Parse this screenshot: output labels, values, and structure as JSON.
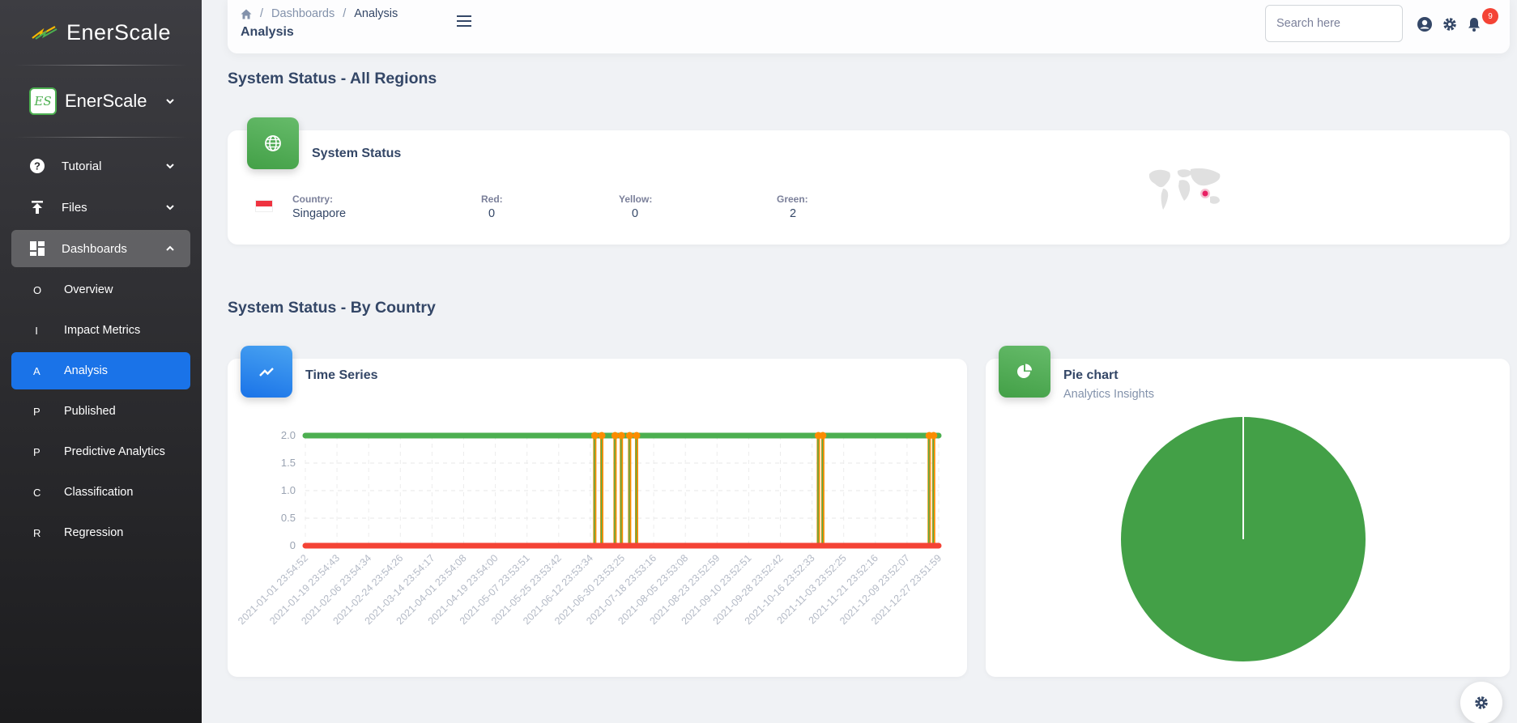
{
  "sidebar": {
    "brand": "EnerScale",
    "org_name": "EnerScale",
    "org_logo_text": "ES",
    "nav": [
      {
        "label": "Tutorial",
        "icon": "help-circle-icon"
      },
      {
        "label": "Files",
        "icon": "upload-icon"
      },
      {
        "label": "Dashboards",
        "icon": "dashboard-icon"
      }
    ],
    "sub_items": [
      {
        "letter": "O",
        "label": "Overview"
      },
      {
        "letter": "I",
        "label": "Impact Metrics"
      },
      {
        "letter": "A",
        "label": "Analysis"
      },
      {
        "letter": "P",
        "label": "Published"
      },
      {
        "letter": "P",
        "label": "Predictive Analytics"
      },
      {
        "letter": "C",
        "label": "Classification"
      },
      {
        "letter": "R",
        "label": "Regression"
      }
    ]
  },
  "topbar": {
    "breadcrumb": [
      "Dashboards",
      "Analysis"
    ],
    "page_title": "Analysis",
    "search_placeholder": "Search here",
    "notification_count": "9"
  },
  "sections": {
    "all_regions": "System Status - All Regions",
    "by_country": "System Status - By Country"
  },
  "status_card": {
    "title": "System Status",
    "country_label": "Country:",
    "country": "Singapore",
    "red_label": "Red:",
    "red": "0",
    "yellow_label": "Yellow:",
    "yellow": "0",
    "green_label": "Green:",
    "green": "2"
  },
  "timeseries_card": {
    "title": "Time Series"
  },
  "pie_card": {
    "title": "Pie chart",
    "subtitle": "Analytics Insights"
  },
  "colors": {
    "accent": "#1a73e8",
    "green": "#4caf50",
    "orange": "#fb8c00",
    "red": "#f44335"
  },
  "chart_data": [
    {
      "type": "line",
      "title": "",
      "ylim": [
        0,
        2
      ],
      "yticks": [
        "2.0",
        "1.5",
        "1.0",
        "0.5",
        "0"
      ],
      "x": [
        "2021-01-01 23:54:52",
        "2021-01-19 23:54:43",
        "2021-02-06 23:54:34",
        "2021-02-24 23:54:26",
        "2021-03-14 23:54:17",
        "2021-04-01 23:54:08",
        "2021-04-19 23:54:00",
        "2021-05-07 23:53:51",
        "2021-05-25 23:53:42",
        "2021-06-12 23:53:34",
        "2021-06-30 23:53:25",
        "2021-07-18 23:53:16",
        "2021-08-05 23:53:08",
        "2021-08-23 23:52:59",
        "2021-09-10 23:52:51",
        "2021-09-28 23:52:42",
        "2021-10-16 23:52:33",
        "2021-11-03 23:52:25",
        "2021-11-21 23:52:16",
        "2021-12-09 23:52:07",
        "2021-12-27 23:51:59"
      ],
      "series": [
        {
          "color": "#4caf50",
          "value": 2
        },
        {
          "color": "#f44335",
          "value": 0
        },
        {
          "color": "#fb8c00",
          "spikes": [
            0.457,
            0.468,
            0.489,
            0.499,
            0.512,
            0.523,
            0.81,
            0.817,
            0.985,
            0.992
          ]
        }
      ]
    },
    {
      "type": "pie",
      "slices": [
        {
          "value": 100,
          "color": "#43a047"
        }
      ]
    }
  ]
}
